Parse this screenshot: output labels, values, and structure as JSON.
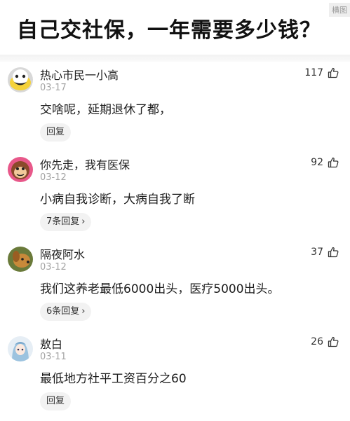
{
  "header": {
    "title": "自己交社保，一年需要多少钱？",
    "watermark": "横图"
  },
  "comments": [
    {
      "username": "热心市民一小高",
      "date": "03-17",
      "likes": "117",
      "content": "交啥呢，延期退休了都，",
      "reply_label": "回复"
    },
    {
      "username": "你先走，我有医保",
      "date": "03-12",
      "likes": "92",
      "content": "小病自我诊断，大病自我了断",
      "reply_label": "7条回复",
      "reply_chevron": "›"
    },
    {
      "username": "隔夜阿水",
      "date": "03-12",
      "likes": "37",
      "content": "我们这养老最低6000出头，医疗5000出头。",
      "reply_label": "6条回复",
      "reply_chevron": "›"
    },
    {
      "username": "敖白",
      "date": "03-11",
      "likes": "26",
      "content": "最低地方社平工资百分之60",
      "reply_label": "回复"
    }
  ],
  "icons": {
    "like": "thumbs-up-outline-icon"
  },
  "colors": {
    "title": "#111111",
    "date": "#a3a3a3",
    "reply_pill": "#f2f2f2"
  }
}
